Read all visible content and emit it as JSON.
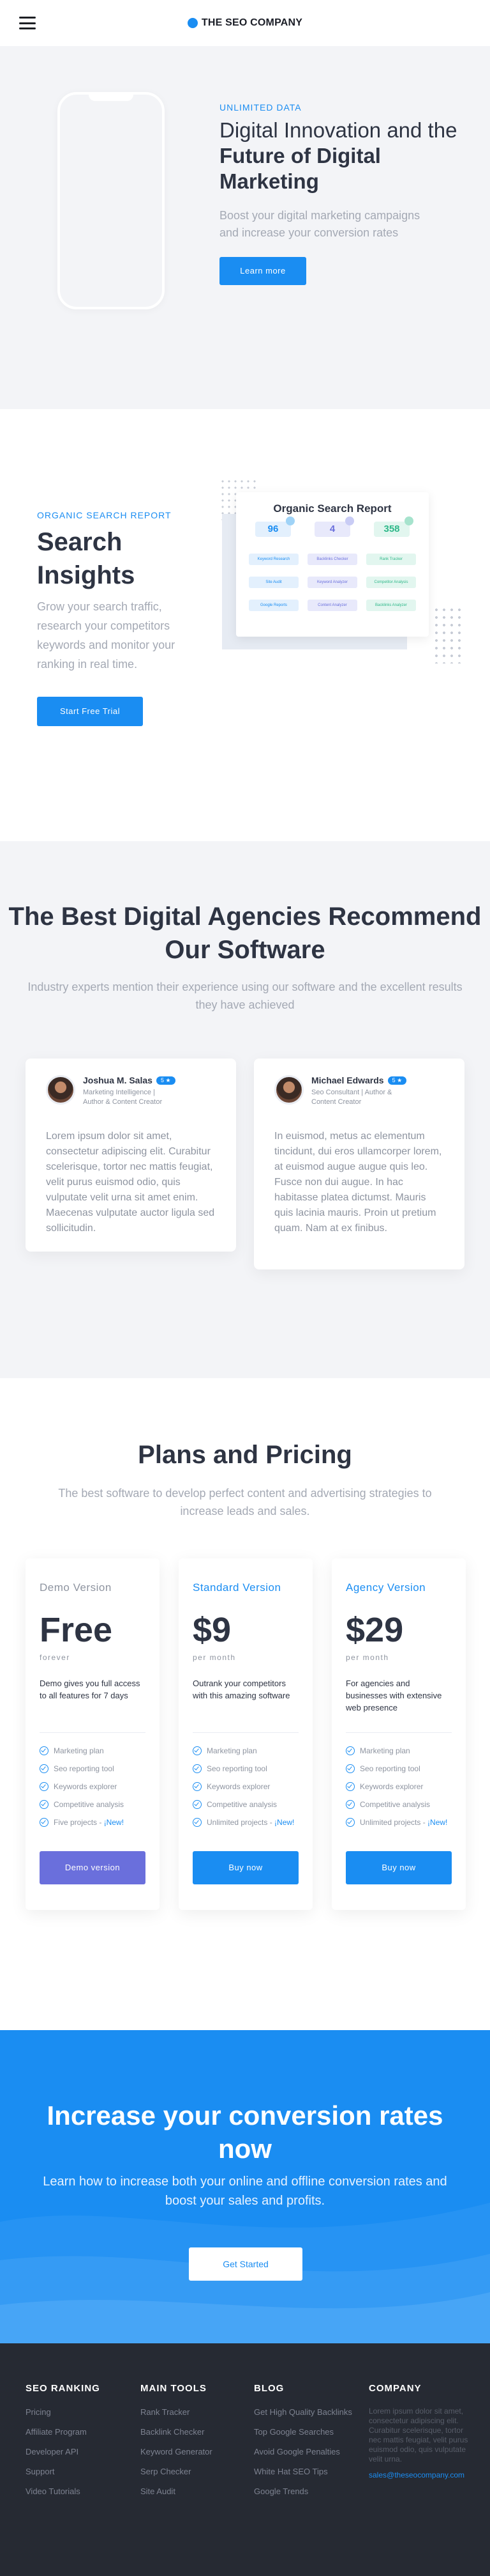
{
  "header": {
    "brand": "THE SEO COMPANY"
  },
  "hero": {
    "eyebrow": "UNLIMITED DATA",
    "title_line1": "Digital Innovation and the",
    "title_bold": "Future of Digital Marketing",
    "subtitle": "Boost your digital marketing campaigns and increase your conversion rates",
    "cta": "Learn more"
  },
  "organic": {
    "eyebrow": "ORGANIC SEARCH REPORT",
    "title": "Search Insights",
    "subtitle": "Grow your search traffic, research your competitors keywords and monitor your ranking in real time.",
    "cta": "Start Free Trial",
    "report": {
      "title": "Organic Search Report",
      "stats": [
        {
          "value": "96",
          "color": "#1a8df2",
          "bg": "#e3f0fd",
          "dot": "#9fd3f7"
        },
        {
          "value": "4",
          "color": "#6a6fdc",
          "bg": "#e8e9fb",
          "dot": "#c9ccf5"
        },
        {
          "value": "358",
          "color": "#2eb889",
          "bg": "#e2f6ef",
          "dot": "#a6e3cd"
        }
      ],
      "chips": [
        {
          "label": "Keyword Research",
          "color": "#1a8df2",
          "bg": "#e3f0fd"
        },
        {
          "label": "Backlinks Checker",
          "color": "#6a6fdc",
          "bg": "#e8e9fb"
        },
        {
          "label": "Rank Tracker",
          "color": "#2eb889",
          "bg": "#e2f6ef"
        },
        {
          "label": "Site Audit",
          "color": "#1a8df2",
          "bg": "#e3f0fd"
        },
        {
          "label": "Keyword Analyzer",
          "color": "#6a6fdc",
          "bg": "#e8e9fb"
        },
        {
          "label": "Competitor Analysis",
          "color": "#2eb889",
          "bg": "#e2f6ef"
        },
        {
          "label": "Google Reports",
          "color": "#1a8df2",
          "bg": "#e3f0fd"
        },
        {
          "label": "Content Analyzer",
          "color": "#6a6fdc",
          "bg": "#e8e9fb"
        },
        {
          "label": "Backlinks Analyzer",
          "color": "#2eb889",
          "bg": "#e2f6ef"
        }
      ]
    }
  },
  "testimonials": {
    "title": "The Best Digital Agencies Recommend Our Software",
    "subtitle": "Industry experts mention their experience using our software and the excellent results they have achieved",
    "items": [
      {
        "name": "Joshua M. Salas",
        "stars": "5 ★",
        "role": "Marketing Intelligence | Author & Content Creator",
        "quote": "Lorem ipsum dolor sit amet, consectetur adipiscing elit. Curabitur scelerisque, tortor nec mattis feugiat, velit purus euismod odio, quis vulputate velit urna sit amet enim. Maecenas vulputate auctor ligula sed sollicitudin."
      },
      {
        "name": "Michael Edwards",
        "stars": "5 ★",
        "role": "Seo Consultant | Author & Content Creator",
        "quote": "In euismod, metus ac elementum tincidunt, dui eros ullamcorper lorem, at euismod augue augue quis leo. Fusce non dui augue. In hac habitasse platea dictumst. Mauris quis lacinia mauris. Proin ut pretium quam. Nam at ex finibus."
      }
    ]
  },
  "pricing": {
    "title": "Plans and Pricing",
    "subtitle": "The best software to develop perfect content and advertising strategies to increase leads and sales.",
    "plans": [
      {
        "name": "Demo Version",
        "price": "Free",
        "period": "forever",
        "description": "Demo gives you full access to all features for 7 days",
        "features": [
          "Marketing plan",
          "Seo reporting tool",
          "Keywords explorer",
          "Competitive analysis",
          "Five projects - "
        ],
        "new_label": "¡New!",
        "button": "Demo version",
        "accent": "#8e94a0"
      },
      {
        "name": "Standard Version",
        "price": "$9",
        "period": "per month",
        "description": "Outrank your competitors with this amazing software",
        "features": [
          "Marketing plan",
          "Seo reporting tool",
          "Keywords explorer",
          "Competitive analysis",
          "Unlimited projects - "
        ],
        "new_label": "¡New!",
        "button": "Buy now",
        "accent": "#1a8df2"
      },
      {
        "name": "Agency Version",
        "price": "$29",
        "period": "per month",
        "description": "For agencies and businesses with extensive web presence",
        "features": [
          "Marketing plan",
          "Seo reporting tool",
          "Keywords explorer",
          "Competitive analysis",
          "Unlimited projects - "
        ],
        "new_label": "¡New!",
        "button": "Buy now",
        "accent": "#1a8df2"
      }
    ]
  },
  "cta": {
    "title": "Increase your conversion rates now",
    "subtitle": "Learn how to increase both your online and offline conversion rates and boost your sales and profits.",
    "button": "Get Started"
  },
  "footer": {
    "columns": [
      {
        "heading": "SEO RANKING",
        "links": [
          "Pricing",
          "Affiliate Program",
          "Developer API",
          "Support",
          "Video Tutorials"
        ]
      },
      {
        "heading": "MAIN TOOLS",
        "links": [
          "Rank Tracker",
          "Backlink Checker",
          "Keyword Generator",
          "Serp Checker",
          "Site Audit"
        ]
      },
      {
        "heading": "BLOG",
        "links": [
          "Get High Quality Backlinks",
          "Top Google Searches",
          "Avoid Google Penalties",
          "White Hat SEO Tips",
          "Google Trends"
        ]
      }
    ],
    "company": {
      "heading": "COMPANY",
      "about": "Lorem ipsum dolor sit amet, consectetur adipiscing elit. Curabitur scelerisque, tortor nec mattis feugiat, velit purus euismod odio, quis vulputate velit urna.",
      "email": "sales@theseocompany.com"
    }
  }
}
